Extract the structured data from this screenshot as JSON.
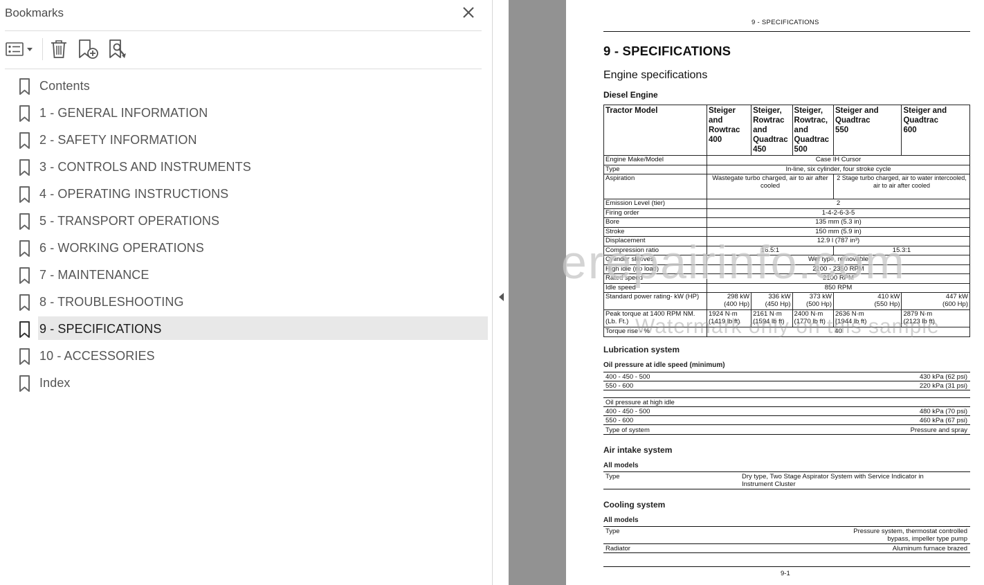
{
  "panel": {
    "title": "Bookmarks",
    "items": [
      {
        "label": "Contents"
      },
      {
        "label": "1 - GENERAL INFORMATION"
      },
      {
        "label": "2 - SAFETY INFORMATION"
      },
      {
        "label": "3 - CONTROLS AND INSTRUMENTS"
      },
      {
        "label": "4 - OPERATING INSTRUCTIONS"
      },
      {
        "label": "5 - TRANSPORT OPERATIONS"
      },
      {
        "label": "6 - WORKING OPERATIONS"
      },
      {
        "label": "7 - MAINTENANCE"
      },
      {
        "label": "8 - TROUBLESHOOTING"
      },
      {
        "label": "9 - SPECIFICATIONS",
        "selected": true
      },
      {
        "label": "10 - ACCESSORIES"
      },
      {
        "label": "Index"
      }
    ]
  },
  "doc": {
    "running_head": "9 - SPECIFICATIONS",
    "title": "9 - SPECIFICATIONS",
    "section": "Engine specifications",
    "subsection": "Diesel Engine",
    "table": {
      "headers": [
        "Tractor Model",
        "Steiger and\nRowtrac\n400",
        "Steiger,\nRowtrac\nand\nQuadtrac\n450",
        "Steiger,\nRowtrac,\nand\nQuadtrac\n500",
        "Steiger and\nQuadtrac\n550",
        "Steiger and\nQuadtrac\n600"
      ],
      "engine_make_label": "Engine Make/Model",
      "engine_make": "Case IH Cursor",
      "type_label": "Type",
      "type": "In-line, six cylinder, four stroke cycle",
      "aspiration_label": "Aspiration",
      "aspiration_a": "Wastegate turbo charged, air to air after cooled",
      "aspiration_b": "2 Stage turbo charged, air to water intercooled, air to air after cooled",
      "emission_label": "Emission Level (tier)",
      "emission": "2",
      "firing_label": "Firing order",
      "firing": "1-4-2-6-3-5",
      "bore_label": "Bore",
      "bore": "135 mm (5.3 in)",
      "stroke_label": "Stroke",
      "stroke": "150 mm (5.9 in)",
      "displacement_label": "Displacement",
      "displacement": "12.9 l (787 in³)",
      "compression_label": "Compression ratio",
      "compression_a": "16.5:1",
      "compression_b": "15.3:1",
      "sleeves_label": "Cylinder sleeves",
      "sleeves": "Wet type, removable",
      "high_idle_label": "High idle (no load)",
      "high_idle": "2200 - 2350 RPM",
      "rated_label": "Rated speed",
      "rated": "2100 RPM",
      "idle_label": "Idle speed",
      "idle": "850 RPM",
      "power_label": "Standard power rating- kW (HP)",
      "power": [
        "298 kW\n(400 Hp)",
        "336 kW\n(450 Hp)",
        "373 kW\n(500 Hp)",
        "410 kW\n(550 Hp)",
        "447 kW\n(600 Hp)"
      ],
      "torque_label": "Peak torque at 1400 RPM NM. (Lb. Ft.)",
      "torque": [
        "1924 N·m\n(1419 lb ft)",
        "2161 N·m\n(1594 lb ft)",
        "2400 N·m\n(1770 lb ft)",
        "2636 N·m\n(1944 lb ft)",
        "2879 N·m\n(2123 lb ft)"
      ],
      "torque_rise_label": "Torque rise - %",
      "torque_rise": "40"
    },
    "lubrication": {
      "title": "Lubrication system",
      "idle_sub": "Oil pressure at idle speed (minimum)",
      "idle_rows": [
        {
          "label": "400 - 450 - 500",
          "value": "430 kPa (62 psi)"
        },
        {
          "label": "550 - 600",
          "value": "220 kPa (31 psi)"
        }
      ],
      "high_sub": "Oil pressure at high idle",
      "high_rows": [
        {
          "label": "400 - 450 - 500",
          "value": "480 kPa (70 psi)"
        },
        {
          "label": "550 - 600",
          "value": "460 kPa (67 psi)"
        }
      ],
      "type_label": "Type of system",
      "type_value": "Pressure and spray"
    },
    "air": {
      "title": "Air intake system",
      "sub": "All models",
      "type_label": "Type",
      "type_value": "Dry type, Two Stage Aspirator System with Service Indicator in\nInstrument Cluster"
    },
    "cooling": {
      "title": "Cooling system",
      "sub": "All models",
      "type_label": "Type",
      "type_value": "Pressure system, thermostat controlled\nbypass, impeller type pump",
      "radiator_label": "Radiator",
      "radiator_value": "Aluminum furnace brazed"
    },
    "footer": "9-1"
  },
  "watermark": {
    "line1": "erepairinfo.com",
    "line2": "Watermark only on this sample"
  },
  "icons": {
    "close": "close-icon",
    "options": "options-menu-icon",
    "delete": "delete-bookmark-icon",
    "add": "add-bookmark-icon",
    "find": "find-bookmark-icon",
    "bookmark": "bookmark-icon",
    "collapse": "collapse-left-icon"
  }
}
